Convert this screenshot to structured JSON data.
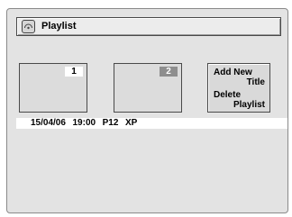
{
  "header": {
    "title": "Playlist",
    "icon": "disc-icon"
  },
  "thumbnails": [
    {
      "number": "1"
    },
    {
      "number": "2"
    }
  ],
  "menu": {
    "add_new": "Add New",
    "title": "Title",
    "delete": "Delete",
    "playlist": "Playlist"
  },
  "info": {
    "date": "15/04/06",
    "time": "19:00",
    "program": "P12",
    "mode": "XP"
  },
  "colors": {
    "background": "#e3e3e3",
    "selected_number_bg": "#8e8e8e",
    "unselected_number_bg": "#ffffff"
  }
}
